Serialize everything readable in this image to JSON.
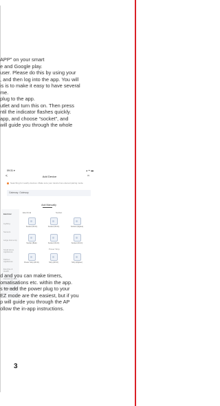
{
  "intro_lines": [
    "APP” on your smart",
    "e and Google play.",
    "user. Please do this by using your",
    ", and then log into the app. You will",
    "is is to make it easy to have several",
    "me.",
    "plug to the app.",
    "utlet and turn this on. Then press",
    "ntil the indicator flashes quickly.",
    "app, and choose “socket”, and",
    "will guide you through the whole"
  ],
  "outro_lines": [
    "d and you can make timers,",
    "omatisations etc. within the app.",
    "s to add the power plug to your",
    "EZ mode are the easiest, but if you",
    "p will guide you through the AP",
    "ollow the in-app instructions."
  ],
  "phone": {
    "status_time": "09:31 ▾",
    "status_icons": "▴ ᯤ ▬",
    "back_icon": "<",
    "title": "Add Device",
    "scan_icon": "⌗",
    "search_hint": "Searching for nearby devices. Make sure your device has entered pairing mode.",
    "gateway": "Gateway: Gateway",
    "add_manually": "Add Manually",
    "sidebar": [
      "Electrical",
      "Lighting",
      "Sensors",
      "Large Home Ap.",
      "Small Home Appliances",
      "Kitchen Appliances",
      "Exercise & Health",
      "Camera & Lock",
      "Gateway Control"
    ],
    "categories": {
      "left": "Electrical",
      "right": "Socket"
    },
    "devices_row1": [
      {
        "label": "Socket (Wi-Fi)"
      },
      {
        "label": "Socket (Wi-Fi)"
      },
      {
        "label": "Socket (Zigbee)"
      }
    ],
    "devices_row2": [
      {
        "label": "Socket (BLE)"
      },
      {
        "label": "Socket (Wi-Fi)"
      },
      {
        "label": "Socket (Wi-Fi)"
      }
    ],
    "section_power_strip": "Power Strip",
    "devices_row3": [
      {
        "label": "Power Strip (Wi-Fi)"
      },
      {
        "label": "Strip (Wi-Fi)"
      },
      {
        "label": "Strip (Zigbee)"
      }
    ]
  },
  "page_number": "3",
  "accent_color": "#d91f26"
}
